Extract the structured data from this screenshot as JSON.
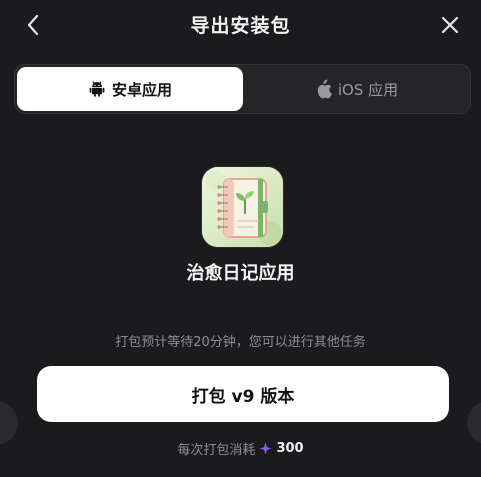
{
  "header": {
    "title": "导出安装包",
    "back_icon": "chevron-left-icon",
    "close_icon": "close-icon"
  },
  "tabs": [
    {
      "label": "安卓应用",
      "icon": "android-icon",
      "selected": true
    },
    {
      "label": "iOS 应用",
      "icon": "apple-icon",
      "selected": false
    }
  ],
  "app": {
    "icon": "notebook-sprout-icon",
    "name": "治愈日记应用"
  },
  "hint": "打包预计等待20分钟，您可以进行其他任务",
  "pack_button": {
    "label": "打包 v9 版本"
  },
  "cost": {
    "label": "每次打包消耗",
    "icon": "sparkle-icon",
    "value": "300"
  },
  "colors": {
    "background": "#1b1b1d",
    "accent_sparkle": "#8b5cf6",
    "button_bg": "#ffffff"
  }
}
